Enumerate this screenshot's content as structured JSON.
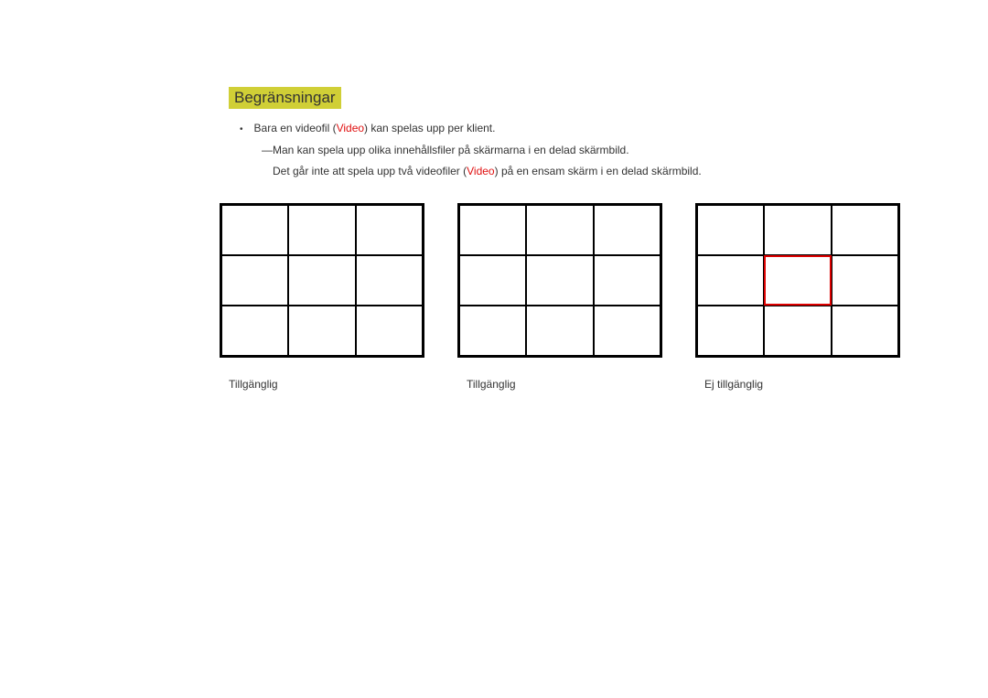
{
  "heading": "Begränsningar",
  "bullet": "•",
  "bullet_text_pre": "Bara en videofil (",
  "video_word_1": "Video",
  "bullet_text_post": ") kan spelas upp per klient.",
  "subnote1": "Man kan spela upp olika innehållsfiler på skärmarna i en delad skärmbild.",
  "subnote2_pre": "Det går inte att spela upp två videofiler (",
  "video_word_2": "Video",
  "subnote2_post": ") på en ensam skärm i en delad skärmbild.",
  "dash": "―",
  "captions": {
    "c1": "Tillgänglig",
    "c2": "Tillgänglig",
    "c3": "Ej tillgänglig"
  }
}
